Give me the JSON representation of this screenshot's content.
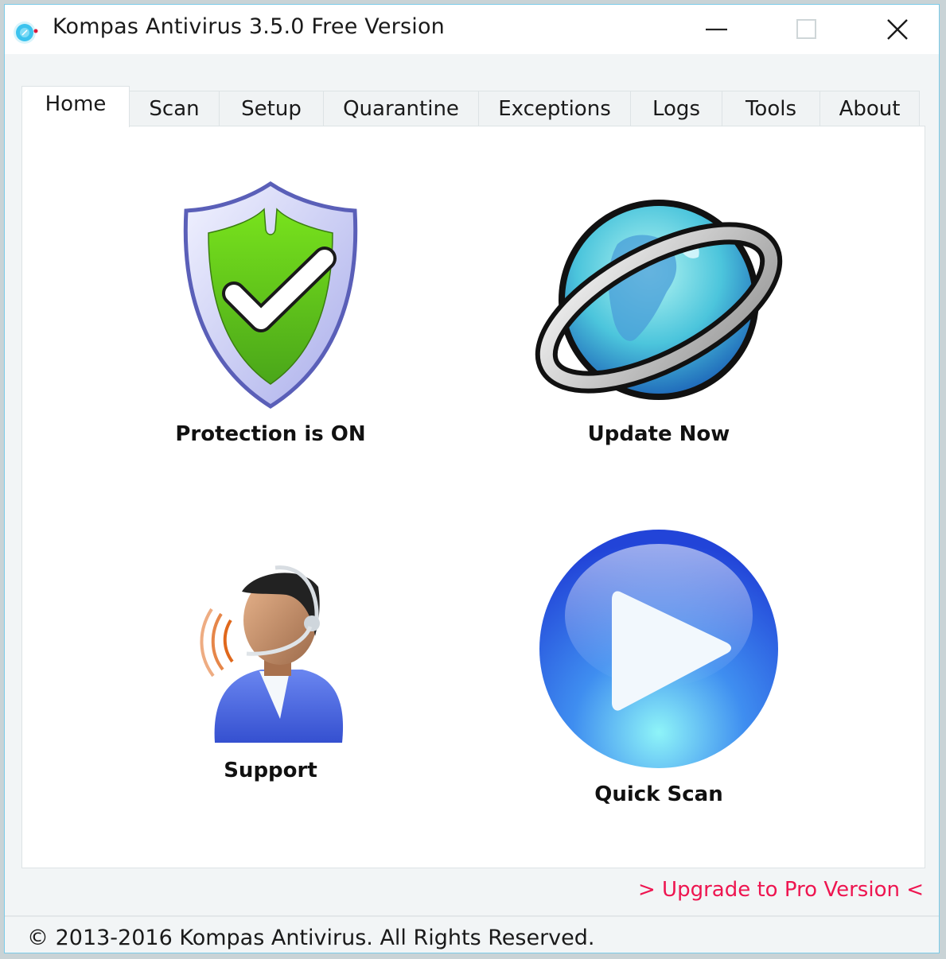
{
  "window": {
    "title": "Kompas Antivirus 3.5.0 Free Version",
    "app_icon": "kompas-logo-icon",
    "controls": {
      "minimize_icon": "minimize-icon",
      "maximize_icon": "maximize-icon",
      "close_icon": "close-icon"
    }
  },
  "tabs": [
    {
      "label": "Home",
      "active": true
    },
    {
      "label": "Scan",
      "active": false
    },
    {
      "label": "Setup",
      "active": false
    },
    {
      "label": "Quarantine",
      "active": false
    },
    {
      "label": "Exceptions",
      "active": false
    },
    {
      "label": "Logs",
      "active": false
    },
    {
      "label": "Tools",
      "active": false
    },
    {
      "label": "About",
      "active": false
    }
  ],
  "home": {
    "tiles": [
      {
        "label": "Protection is ON",
        "icon": "shield-check-icon"
      },
      {
        "label": "Update Now",
        "icon": "globe-icon"
      },
      {
        "label": "Support",
        "icon": "support-agent-icon"
      },
      {
        "label": "Quick Scan",
        "icon": "play-icon"
      }
    ]
  },
  "upgrade_link": "> Upgrade to Pro Version <",
  "status_bar": {
    "text": "© 2013-2016 Kompas Antivirus. All Rights Reserved."
  },
  "colors": {
    "accent_link": "#ee1550",
    "window_border": "#7ccbe8",
    "shield_green": "#6cc51e",
    "play_blue": "#2a63e6"
  }
}
